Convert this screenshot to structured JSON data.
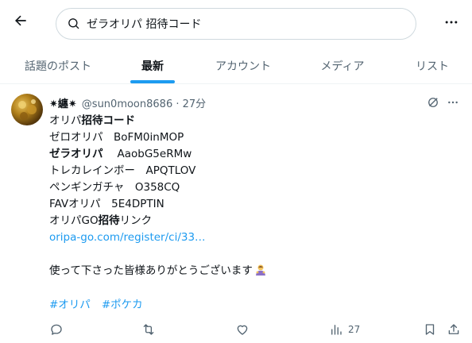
{
  "search": {
    "query": "ゼラオリパ 招待コード"
  },
  "tabs": [
    {
      "label": "話題のポスト"
    },
    {
      "label": "最新"
    },
    {
      "label": "アカウント"
    },
    {
      "label": "メディア"
    },
    {
      "label": "リスト"
    }
  ],
  "active_tab": "最新",
  "tweet": {
    "display_name": "✷纏✷",
    "meta": "@sun0moon8686 · 27分",
    "lines": {
      "l1a": "オリパ",
      "l1b": "招待コード",
      "l2": "ゼロオリパ　BoFM0inMOP",
      "l3a": "ゼラオリパ",
      "l3b": "AaobG5eRMw",
      "l4": "トレカレインボー　APQTLOV",
      "l5": "ペンギンガチャ　O358CQ",
      "l6": "FAVオリパ　5E4DPTIN",
      "l7a": "オリパGO",
      "l7b": "招待",
      "l7c": "リンク",
      "link": "oripa-go.com/register/ci/33…",
      "thanks": "使って下さった皆様ありがとうございます"
    },
    "hashtags": [
      "#オリパ",
      "#ポケカ"
    ],
    "views": "27"
  },
  "colors": {
    "accent": "#1d9bf0",
    "text": "#0f1419",
    "muted": "#536471",
    "border": "#cfd9de"
  },
  "icons": [
    "back-arrow-icon",
    "search-icon",
    "more-icon",
    "grok-icon",
    "reply-icon",
    "retweet-icon",
    "like-icon",
    "views-icon",
    "bookmark-icon",
    "share-icon"
  ]
}
